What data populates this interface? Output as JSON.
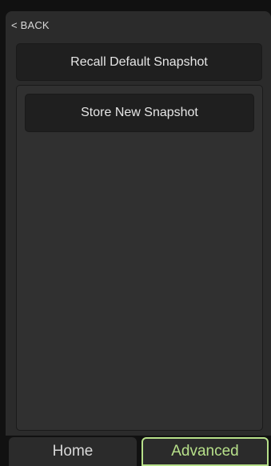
{
  "nav": {
    "back_label": "< BACK"
  },
  "actions": {
    "recall_label": "Recall Default Snapshot",
    "store_label": "Store New Snapshot"
  },
  "tabs": [
    {
      "label": "Home",
      "active": false
    },
    {
      "label": "Advanced",
      "active": true
    }
  ],
  "colors": {
    "accent": "#b7e08a",
    "background": "#2b2b2b",
    "button": "#1f1f1f"
  }
}
